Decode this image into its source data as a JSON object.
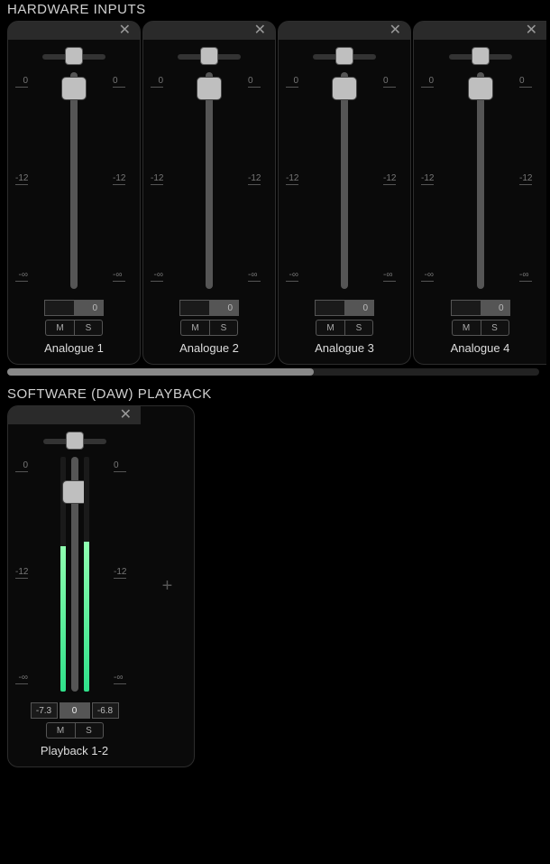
{
  "sections": {
    "hardware_title": "HARDWARE INPUTS",
    "software_title": "SOFTWARE (DAW) PLAYBACK"
  },
  "scale_labels": {
    "top": "0",
    "mid": "-12",
    "bot": "-∞"
  },
  "buttons": {
    "mute": "M",
    "solo": "S",
    "close": "✕",
    "add": "+"
  },
  "hardware_channels": [
    {
      "label": "Analogue 1",
      "gain": "0",
      "pan": 0.5,
      "fader": 0.96,
      "meter_l": 0,
      "meter_r": 0
    },
    {
      "label": "Analogue 2",
      "gain": "0",
      "pan": 0.5,
      "fader": 0.96,
      "meter_l": 0,
      "meter_r": 0
    },
    {
      "label": "Analogue 3",
      "gain": "0",
      "pan": 0.5,
      "fader": 0.96,
      "meter_l": 0,
      "meter_r": 0
    },
    {
      "label": "Analogue 4",
      "gain": "0",
      "pan": 0.5,
      "fader": 0.96,
      "meter_l": 0,
      "meter_r": 0
    }
  ],
  "software_channels": [
    {
      "label": "Playback 1-2",
      "gain": "0",
      "peak_l": "-7.3",
      "peak_r": "-6.8",
      "pan": 0.5,
      "fader": 0.88,
      "meter_l": 0.62,
      "meter_r": 0.64
    }
  ]
}
